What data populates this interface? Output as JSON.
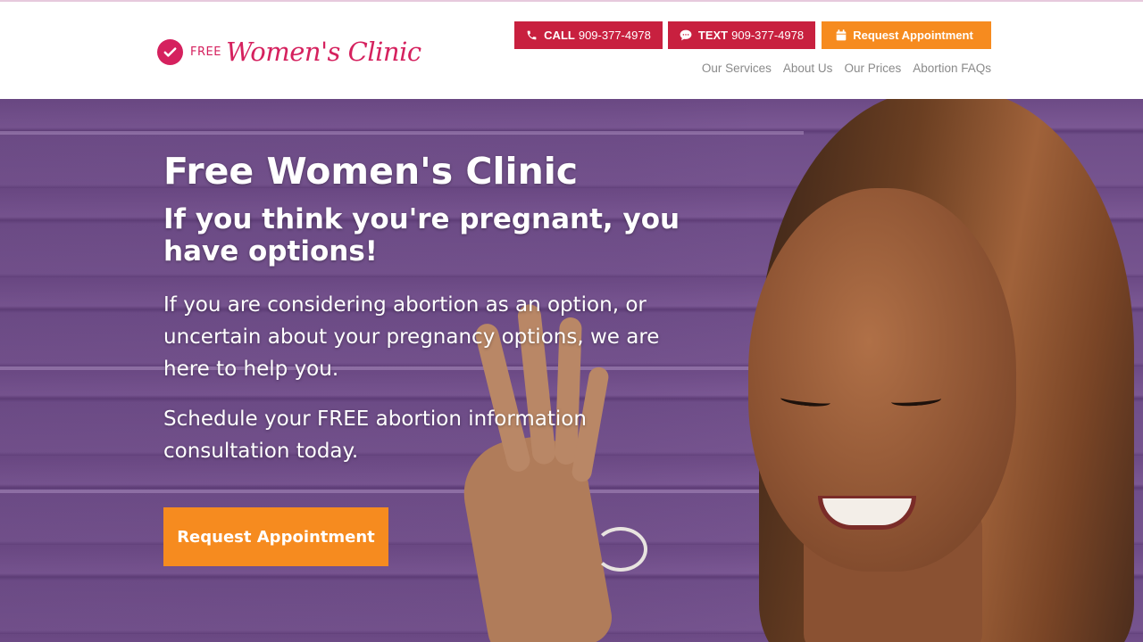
{
  "brand": {
    "free_label": "FREE",
    "script_name": "Women's Clinic",
    "accent": "#d5215e"
  },
  "header": {
    "call": {
      "label": "CALL",
      "number": "909-377-4978",
      "icon": "phone-icon",
      "color": "#c8203f"
    },
    "text": {
      "label": "TEXT",
      "number": "909-377-4978",
      "icon": "chat-icon",
      "color": "#c8203f"
    },
    "request": {
      "label": "Request Appointment",
      "icon": "calendar-icon",
      "color": "#f68b1f"
    },
    "nav": [
      "Our Services",
      "About Us",
      "Our Prices",
      "Abortion FAQs"
    ]
  },
  "hero": {
    "title": "Free Women's Clinic",
    "subtitle": "If you think you're pregnant, you have options!",
    "paragraph1": "If you are considering abortion as an option, or uncertain about your pregnancy options, we are here to help you.",
    "paragraph2": "Schedule your FREE abortion information consultation today.",
    "cta_label": "Request Appointment"
  }
}
